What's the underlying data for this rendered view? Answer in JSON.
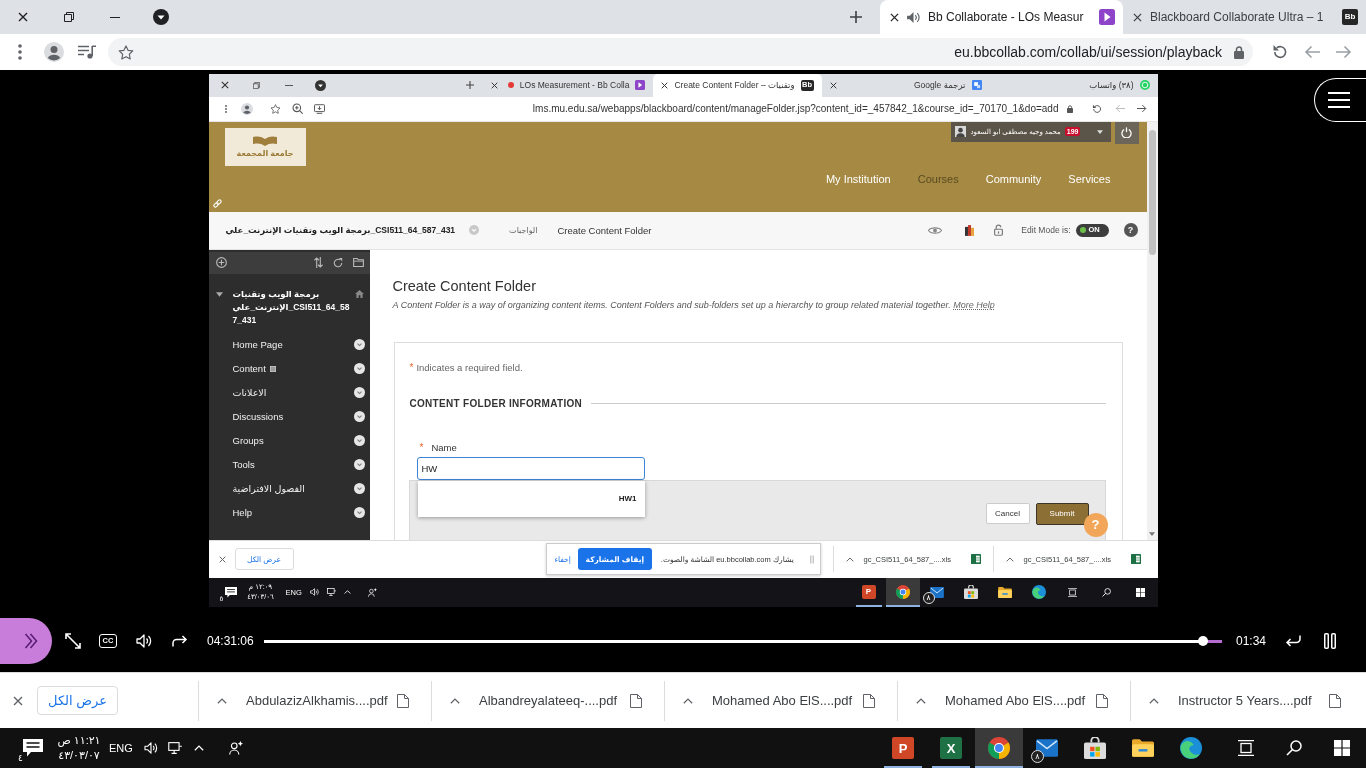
{
  "browser": {
    "tabs": [
      {
        "title": "Blackboard Collaborate Ultra – 1",
        "selected": false,
        "audio": false,
        "kind": "bb",
        "icon_text": "Bb"
      },
      {
        "title": "Bb Collaborate - LOs Measur",
        "selected": true,
        "audio": true,
        "kind": "collab"
      }
    ],
    "url": "eu.bbcollab.com/collab/ui/session/playback"
  },
  "shared_screen": {
    "tabs": [
      {
        "title": "(٣٨) واتساب",
        "selected": false,
        "recording": false,
        "closable": false,
        "kind": "whatsapp"
      },
      {
        "title": "ترجمة Google",
        "selected": false,
        "recording": false,
        "closable": true,
        "kind": "translate"
      },
      {
        "title": "Create Content Folder – وتقنيات",
        "selected": true,
        "recording": false,
        "closable": true,
        "kind": "bb",
        "icon_text": "Bb"
      },
      {
        "title": "LOs Measurement - Bb Colla",
        "selected": false,
        "recording": true,
        "closable": true,
        "kind": "collab"
      }
    ],
    "url": "lms.mu.edu.sa/webapps/blackboard/content/manageFolder.jsp?content_id=_457842_1&course_id=_70170_1&do=add",
    "header": {
      "logo": "جامعة المجمعة",
      "user": "محمد وجيه مصطفى ابو السعود",
      "notifications": "199",
      "nav": [
        {
          "label": "Services",
          "selected": false
        },
        {
          "label": "Community",
          "selected": false
        },
        {
          "label": "Courses",
          "selected": true
        },
        {
          "label": "My Institution",
          "selected": false
        }
      ]
    },
    "breadcrumbs": [
      "Create Content Folder",
      "الواجبات",
      "برمجة الويب وتقنيات الإنترنت_علي_CSI511_64_587_431"
    ],
    "edit_mode": {
      "label": "Edit Mode is:",
      "value": "ON",
      "on": true
    },
    "help": "?",
    "course_menu": {
      "title": "برمجة الويب وتقنيات الإنترنت_علي_CSI511_64_587_431",
      "expanded": true,
      "items": [
        {
          "label": "Home Page",
          "empty": false
        },
        {
          "label": "Content",
          "empty": true
        },
        {
          "label": "الاعلانات",
          "empty": false
        },
        {
          "label": "Discussions",
          "empty": false
        },
        {
          "label": "Groups",
          "empty": false
        },
        {
          "label": "Tools",
          "empty": false
        },
        {
          "label": "الفصول الافتراضية",
          "empty": false
        },
        {
          "label": "Help",
          "empty": false
        }
      ]
    },
    "form": {
      "title": "Create Content Folder",
      "description": "A Content Folder is a way of organizing content items. Content Folders and sub-folders set up a hierarchy to group related material together.",
      "help_link": "More Help",
      "required_note": {
        "mark": "*",
        "text": "Indicates a required field."
      },
      "section": "CONTENT FOLDER INFORMATION",
      "field": {
        "mark": "*",
        "label": "Name",
        "value": "HW",
        "focused": true,
        "suggestions": [
          "HW1"
        ]
      },
      "buttons": [
        {
          "label": "Submit",
          "kind": "primary"
        },
        {
          "label": "Cancel",
          "kind": "secondary"
        }
      ],
      "help_bubble": "?"
    },
    "downloads": {
      "show_all": "عرض الكل",
      "sharing": {
        "message": "يشارك eu.bbcollab.com الشاشة والصوت.",
        "stop": "إيقاف المشاركة",
        "hide": "إخفاء"
      },
      "items": [
        {
          "name": "gc_CSI511_64_587_....xls",
          "kind": "xls"
        },
        {
          "name": "gc_CSI511_64_587_....xls",
          "kind": "xls"
        }
      ]
    },
    "taskbar": {
      "notifications": "٥",
      "time": "١٢:٠٩ م",
      "date": "٤٣/٠٣/٠٦",
      "language": "ENG",
      "apps": [
        {
          "kind": "edge",
          "running": false,
          "selected": false
        },
        {
          "kind": "explorer",
          "running": false,
          "selected": false
        },
        {
          "kind": "store",
          "running": false,
          "selected": false
        },
        {
          "kind": "mail",
          "badge": "٨",
          "running": false,
          "selected": false
        },
        {
          "kind": "chrome",
          "running": true,
          "selected": true
        },
        {
          "kind": "powerpoint",
          "letter": "P",
          "running": true,
          "selected": false
        }
      ]
    }
  },
  "player": {
    "captions": "CC",
    "elapsed": "04:31:06",
    "level": 0.98,
    "remaining": "01:34"
  },
  "downloads": {
    "show_all": "عرض الكل",
    "items": [
      {
        "name": "Instructor 5 Years....pdf",
        "kind": "pdf"
      },
      {
        "name": "Mohamed Abo ElS....pdf",
        "kind": "pdf"
      },
      {
        "name": "Mohamed Abo ElS....pdf",
        "kind": "pdf"
      },
      {
        "name": "Albandreyalateeq-....pdf",
        "kind": "pdf"
      },
      {
        "name": "AbdulazizAlkhamis....pdf",
        "kind": "pdf"
      }
    ]
  },
  "taskbar": {
    "notifications": "٤",
    "time": "١١:٢١ ص",
    "date": "٤٣/٠٣/٠٧",
    "language": "ENG",
    "apps": [
      {
        "kind": "edge",
        "running": false,
        "selected": false
      },
      {
        "kind": "explorer",
        "running": false,
        "selected": false
      },
      {
        "kind": "store",
        "running": false,
        "selected": false
      },
      {
        "kind": "mail",
        "badge": "٨",
        "running": false,
        "selected": false
      },
      {
        "kind": "chrome",
        "running": true,
        "selected": true
      },
      {
        "kind": "excel",
        "letter": "X",
        "running": true,
        "selected": false
      },
      {
        "kind": "powerpoint",
        "letter": "P",
        "running": true,
        "selected": false
      }
    ]
  }
}
